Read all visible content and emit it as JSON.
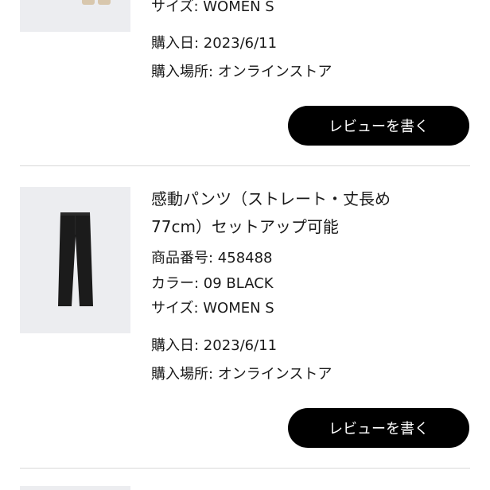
{
  "previous_item": {
    "size_line": "サイズ: WOMEN S",
    "purchase_date": "購入日: 2023/6/11",
    "purchase_place": "購入場所: オンラインストア",
    "review_button": "レビューを書く"
  },
  "item": {
    "title_line1": "感動パンツ（ストレート・丈長め",
    "title_line2": "77cm）セットアップ可能",
    "product_number": "商品番号: 458488",
    "color": "カラー: 09 BLACK",
    "size": "サイズ: WOMEN S",
    "purchase_date": "購入日: 2023/6/11",
    "purchase_place": "購入場所: オンラインストア",
    "review_button": "レビューを書く",
    "image_icon": "black-straight-pants-image"
  },
  "colors": {
    "button_bg": "#000000",
    "thumb_bg": "#ecedf0",
    "pants": "#1b1b1b"
  }
}
